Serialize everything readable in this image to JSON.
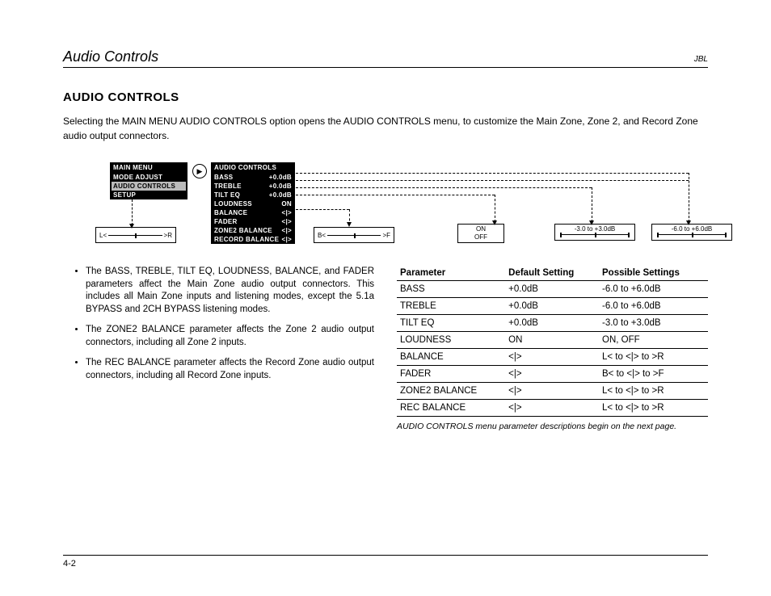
{
  "header": {
    "title": "Audio Controls",
    "brand": "JBL"
  },
  "section_heading": "AUDIO CONTROLS",
  "intro": "Selecting the MAIN MENU AUDIO CONTROLS option opens the AUDIO CONTROLS menu, to customize the Main Zone, Zone 2, and Record Zone audio output connectors.",
  "diagram": {
    "main_menu": {
      "header": "MAIN MENU",
      "items": [
        "MODE ADJUST",
        "AUDIO CONTROLS",
        "SETUP"
      ],
      "selected": "AUDIO CONTROLS"
    },
    "audio_menu": {
      "header": "AUDIO CONTROLS",
      "rows": [
        {
          "label": "BASS",
          "value": "+0.0dB"
        },
        {
          "label": "TREBLE",
          "value": "+0.0dB"
        },
        {
          "label": "TILT EQ",
          "value": "+0.0dB"
        },
        {
          "label": "LOUDNESS",
          "value": "ON"
        },
        {
          "label": "BALANCE",
          "value": "<|>"
        },
        {
          "label": "FADER",
          "value": "<|>"
        },
        {
          "label": "ZONE2 BALANCE",
          "value": "<|>"
        },
        {
          "label": "RECORD BALANCE",
          "value": "<|>"
        }
      ]
    },
    "slider_lr": {
      "left": "L<",
      "right": ">R"
    },
    "slider_bf": {
      "left": "B<",
      "right": ">F"
    },
    "onoff": {
      "on": "ON",
      "off": "OFF"
    },
    "range_3": "-3.0 to +3.0dB",
    "range_6": "-6.0 to +6.0dB"
  },
  "bullets": [
    "The BASS, TREBLE, TILT EQ, LOUDNESS, BALANCE, and FADER parameters affect the Main Zone audio output connectors. This includes all Main Zone inputs and listening modes, except the 5.1a BYPASS and 2CH BYPASS listening modes.",
    "The ZONE2 BALANCE parameter affects the Zone 2 audio output connectors, including all Zone 2 inputs.",
    "The REC BALANCE parameter affects the Record Zone audio output connectors, including all Record Zone inputs."
  ],
  "table": {
    "headers": [
      "Parameter",
      "Default Setting",
      "Possible Settings"
    ],
    "rows": [
      [
        "BASS",
        "+0.0dB",
        "-6.0 to +6.0dB"
      ],
      [
        "TREBLE",
        "+0.0dB",
        "-6.0 to +6.0dB"
      ],
      [
        "TILT EQ",
        "+0.0dB",
        "-3.0 to +3.0dB"
      ],
      [
        "LOUDNESS",
        "ON",
        "ON, OFF"
      ],
      [
        "BALANCE",
        "<|>",
        "L< to <|> to >R"
      ],
      [
        "FADER",
        "<|>",
        "B< to <|> to >F"
      ],
      [
        "ZONE2 BALANCE",
        "<|>",
        "L< to <|> to >R"
      ],
      [
        "REC BALANCE",
        "<|>",
        "L< to <|> to >R"
      ]
    ]
  },
  "footnote": "AUDIO CONTROLS menu parameter descriptions begin on the next page.",
  "page_number": "4-2"
}
